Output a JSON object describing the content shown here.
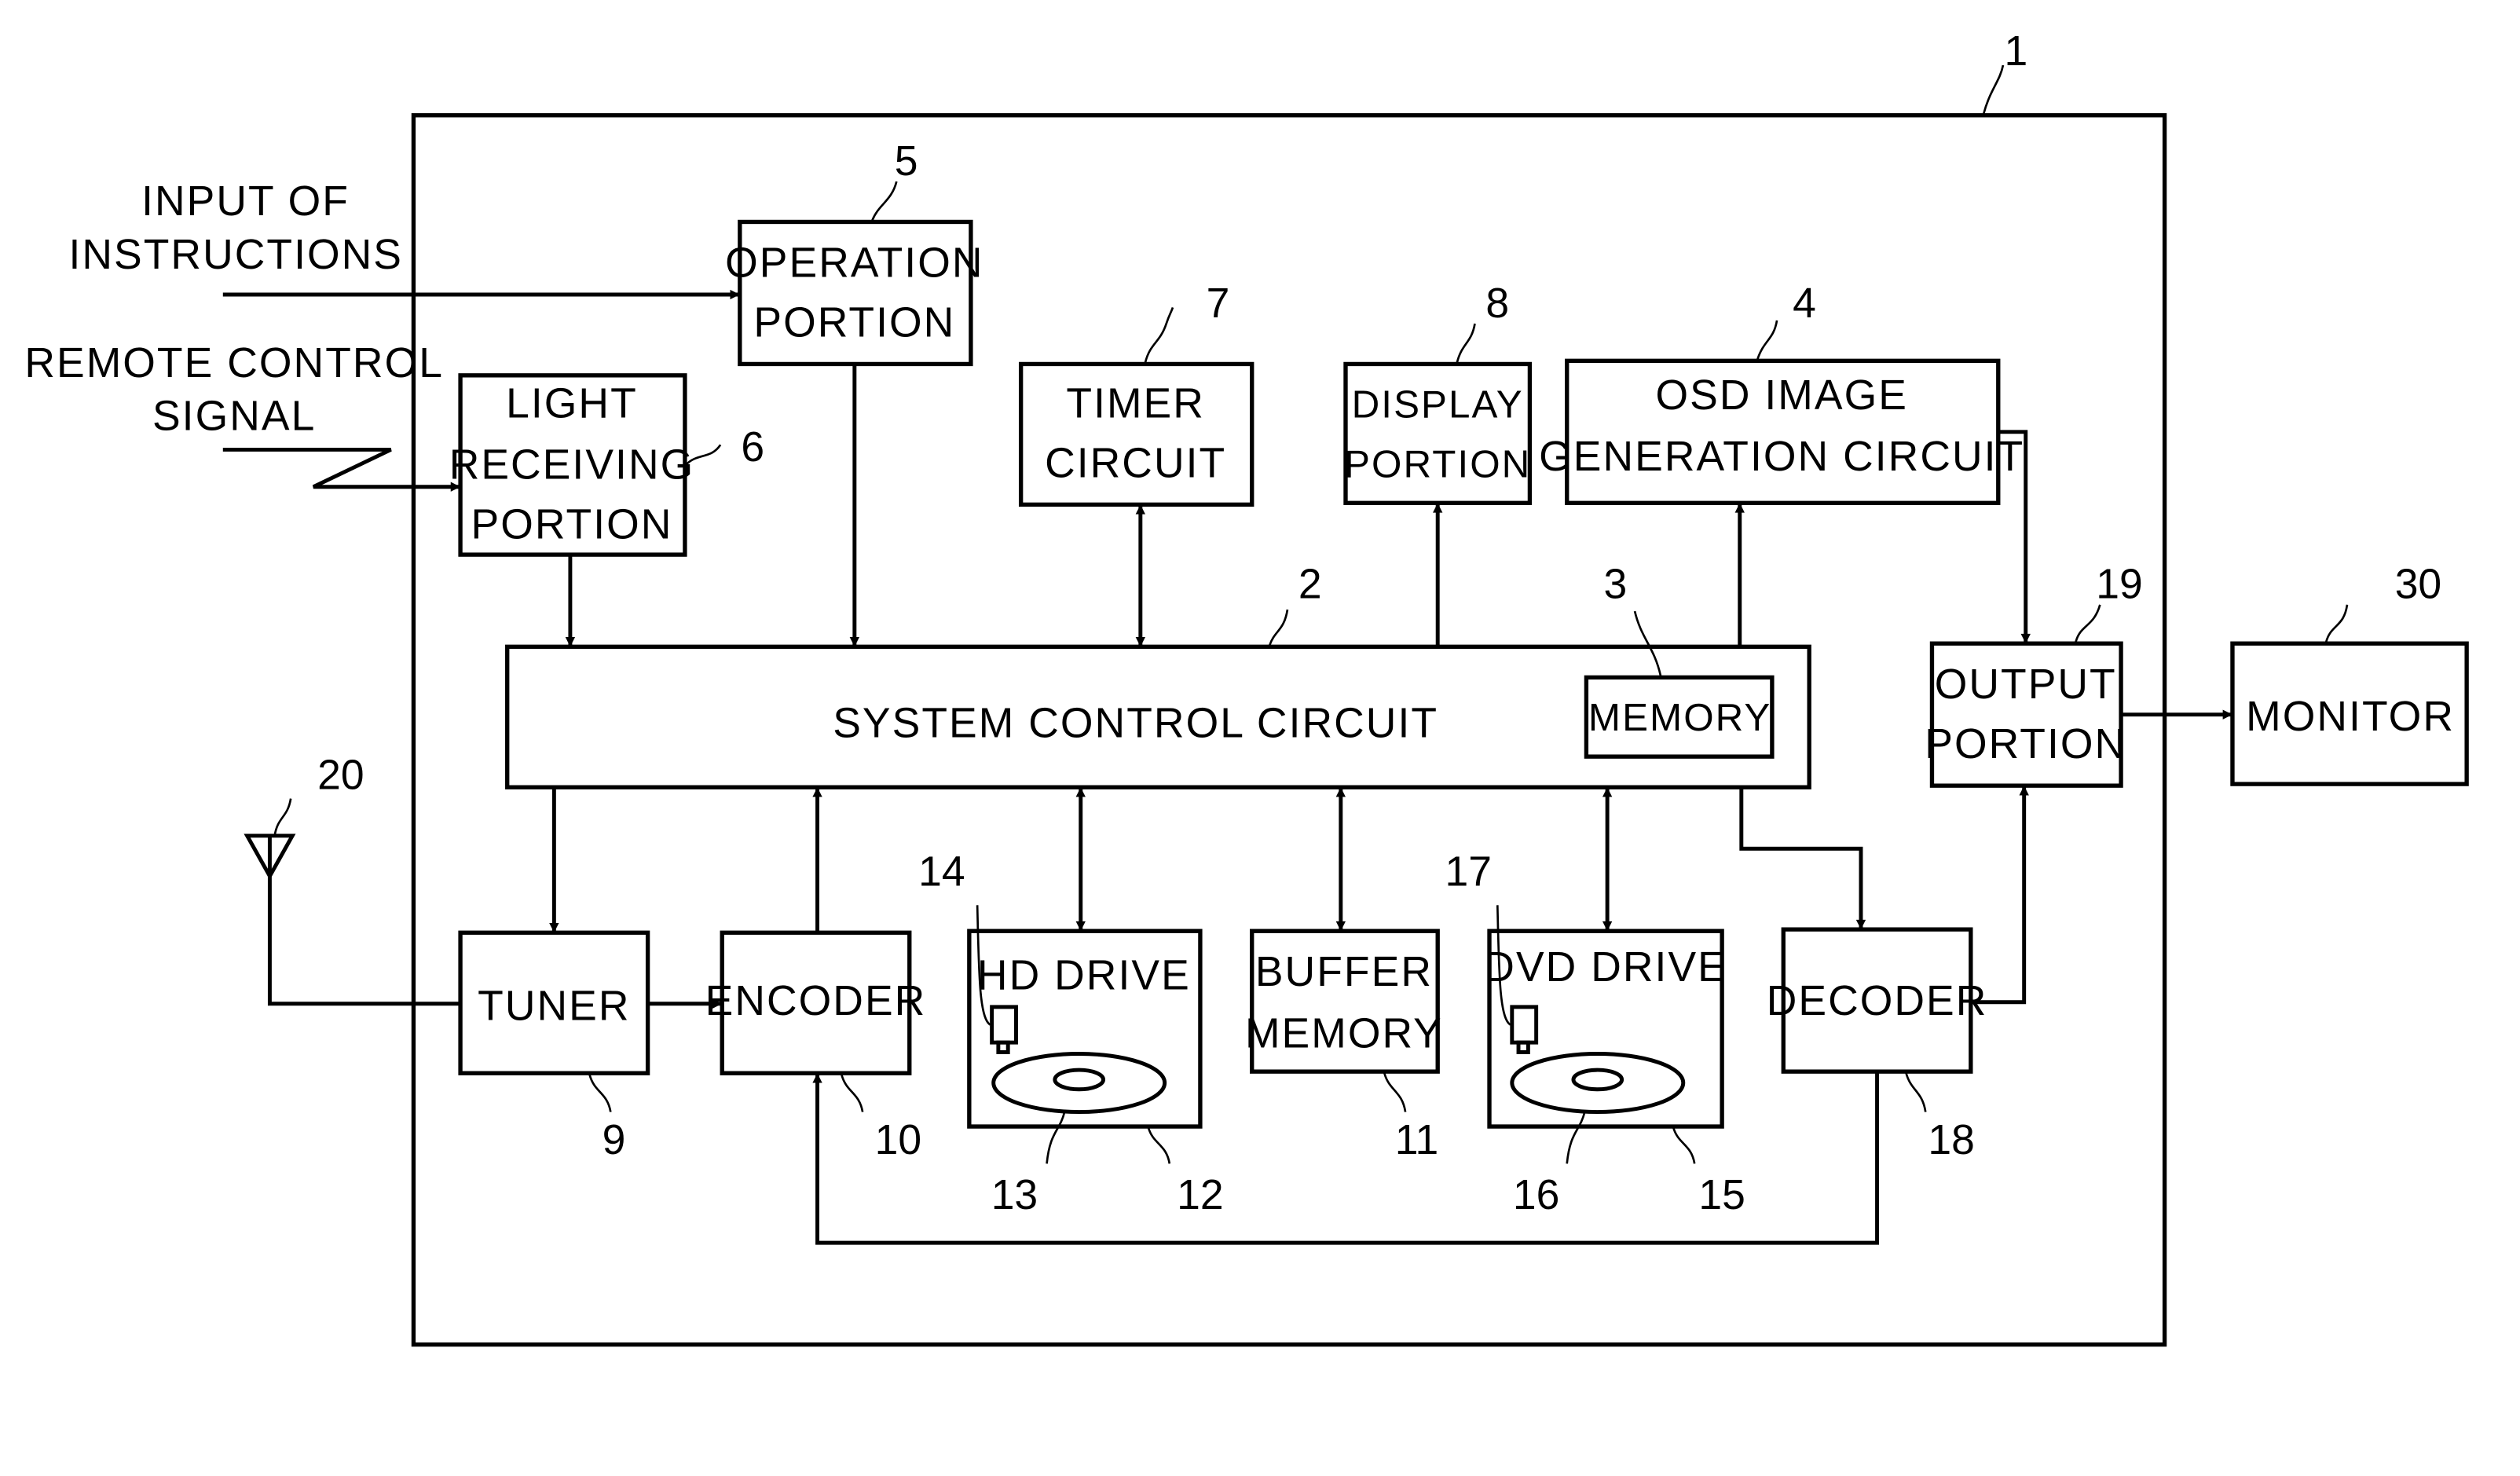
{
  "diagram": {
    "device_ref": "1",
    "external_inputs": {
      "instructions": [
        "INPUT OF",
        "INSTRUCTIONS"
      ],
      "remote": [
        "REMOTE CONTROL",
        "SIGNAL"
      ]
    },
    "blocks": {
      "operation": {
        "ref": "5",
        "lines": [
          "OPERATION",
          "PORTION"
        ]
      },
      "light": {
        "ref": "6",
        "lines": [
          "LIGHT",
          "RECEIVING",
          "PORTION"
        ]
      },
      "timer": {
        "ref": "7",
        "lines": [
          "TIMER",
          "CIRCUIT"
        ]
      },
      "display": {
        "ref": "8",
        "lines": [
          "DISPLAY",
          "PORTION"
        ]
      },
      "osd": {
        "ref": "4",
        "lines": [
          "OSD IMAGE",
          "GENERATION CIRCUIT"
        ]
      },
      "system": {
        "ref": "2",
        "label": "SYSTEM CONTROL CIRCUIT"
      },
      "memory": {
        "ref": "3",
        "label": "MEMORY"
      },
      "output": {
        "ref": "19",
        "lines": [
          "OUTPUT",
          "PORTION"
        ]
      },
      "monitor": {
        "ref": "30",
        "label": "MONITOR"
      },
      "tuner": {
        "ref": "9",
        "label": "TUNER"
      },
      "encoder": {
        "ref": "10",
        "label": "ENCODER"
      },
      "hd_drive": {
        "ref": "12",
        "label": "HD DRIVE",
        "head_ref": "14",
        "disk_ref": "13"
      },
      "buffer": {
        "ref": "11",
        "lines": [
          "BUFFER",
          "MEMORY"
        ]
      },
      "dvd_drive": {
        "ref": "15",
        "label": "DVD DRIVE",
        "head_ref": "17",
        "disk_ref": "16"
      },
      "decoder": {
        "ref": "18",
        "label": "DECODER"
      },
      "antenna": {
        "ref": "20"
      }
    },
    "icons": {
      "antenna": "antenna-icon",
      "remote_signal": "zigzag-signal-icon",
      "disk": "disk-icon",
      "head": "pickup-head-icon"
    }
  }
}
